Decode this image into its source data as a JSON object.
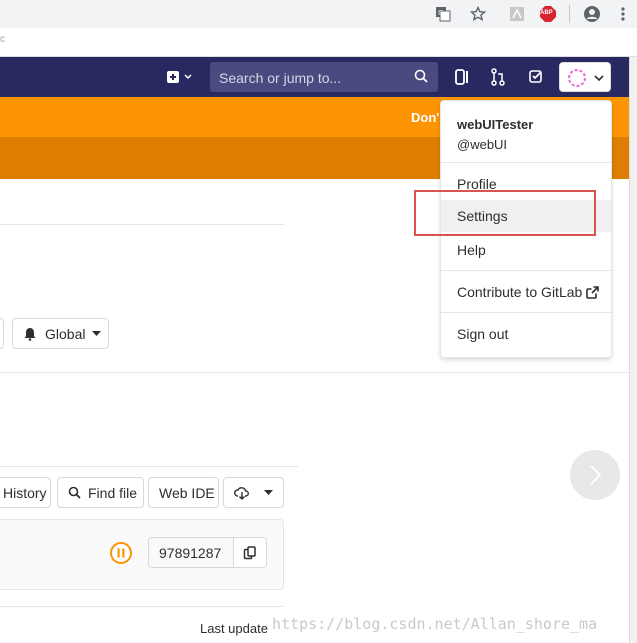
{
  "browser": {
    "url_fragment": "c",
    "extensions": [
      "translate-icon",
      "bookmark-star-icon",
      "pdf-icon",
      "adblock-icon",
      "account-circle-icon",
      "menu-kebab-icon"
    ],
    "adblock_label": "ABP"
  },
  "navbar": {
    "search_placeholder": "Search or jump to...",
    "colors": {
      "bg": "#292961",
      "search_bg": "#4a4a80"
    }
  },
  "banner": {
    "text": "Don'",
    "colors": {
      "primary": "#fc9403",
      "secondary": "#de7e00"
    }
  },
  "toolbar": {
    "notification_label": "Global",
    "history_label": "History",
    "find_file_label": "Find file",
    "web_ide_label": "Web IDE"
  },
  "commit": {
    "sha": "97891287",
    "last_update_label": "Last update"
  },
  "user_menu": {
    "name": "webUITester",
    "username": "@webUI",
    "items": {
      "profile": "Profile",
      "settings": "Settings",
      "help": "Help",
      "contribute": "Contribute to GitLab",
      "sign_out": "Sign out"
    }
  },
  "watermark": "https://blog.csdn.net/Allan_shore_ma"
}
